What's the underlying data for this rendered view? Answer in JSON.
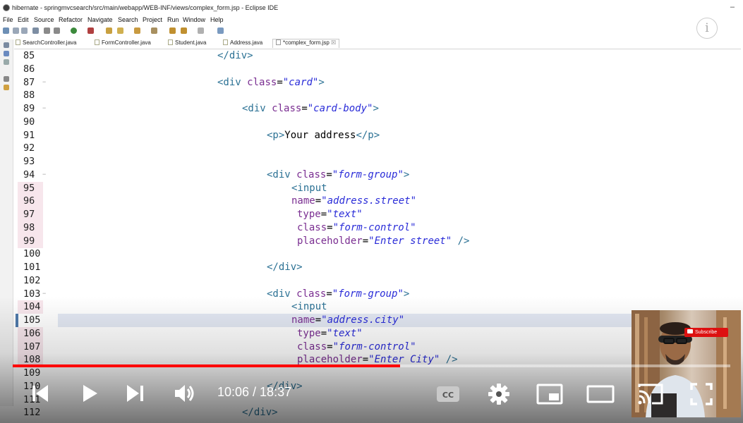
{
  "window": {
    "title": "hibernate - springmvcsearch/src/main/webapp/WEB-INF/views/complex_form.jsp - Eclipse IDE",
    "minimize_label": "–"
  },
  "menu": [
    "File",
    "Edit",
    "Source",
    "Refactor",
    "Navigate",
    "Search",
    "Project",
    "Run",
    "Window",
    "Help"
  ],
  "tabs": [
    {
      "label": "SearchController.java",
      "active": false
    },
    {
      "label": "FormController.java",
      "active": false
    },
    {
      "label": "Student.java",
      "active": false
    },
    {
      "label": "Address.java",
      "active": false
    },
    {
      "label": "*complex_form.jsp",
      "active": true,
      "close": "☒"
    }
  ],
  "info_button": "i",
  "editor": {
    "lines": [
      {
        "n": "85",
        "tokens": [
          [
            "tg",
            "</div>"
          ]
        ]
      },
      {
        "n": "86",
        "tokens": []
      },
      {
        "n": "87",
        "fold": true,
        "tokens": [
          [
            "tg",
            "<div "
          ],
          [
            "at",
            "class"
          ],
          [
            "pt",
            "="
          ],
          [
            "sv",
            "\"card\""
          ],
          [
            "tg",
            ">"
          ]
        ]
      },
      {
        "n": "88",
        "tokens": []
      },
      {
        "n": "89",
        "fold": true,
        "tokens": [
          [
            "tg",
            "<div "
          ],
          [
            "at",
            "class"
          ],
          [
            "pt",
            "="
          ],
          [
            "sv",
            "\"card-body\""
          ],
          [
            "tg",
            ">"
          ]
        ]
      },
      {
        "n": "90",
        "tokens": []
      },
      {
        "n": "91",
        "tokens": [
          [
            "tg",
            "<p>"
          ],
          [
            "pt",
            "Your address"
          ],
          [
            "tg",
            "</p>"
          ]
        ]
      },
      {
        "n": "92",
        "tokens": []
      },
      {
        "n": "93",
        "tokens": []
      },
      {
        "n": "94",
        "fold": true,
        "tokens": [
          [
            "tg",
            "<div "
          ],
          [
            "at",
            "class"
          ],
          [
            "pt",
            "="
          ],
          [
            "sv",
            "\"form-group\""
          ],
          [
            "tg",
            ">"
          ]
        ]
      },
      {
        "n": "95",
        "pink": true,
        "tokens": [
          [
            "tg",
            "<input"
          ]
        ]
      },
      {
        "n": "96",
        "pink": true,
        "tokens": [
          [
            "at",
            "name"
          ],
          [
            "pt",
            "="
          ],
          [
            "sv",
            "\"address.street\""
          ]
        ]
      },
      {
        "n": "97",
        "pink": true,
        "tokens": [
          [
            "at",
            "type"
          ],
          [
            "pt",
            "="
          ],
          [
            "sv",
            "\"text\""
          ]
        ]
      },
      {
        "n": "98",
        "pink": true,
        "tokens": [
          [
            "at",
            "class"
          ],
          [
            "pt",
            "="
          ],
          [
            "sv",
            "\"form-control\""
          ]
        ]
      },
      {
        "n": "99",
        "pink": true,
        "tokens": [
          [
            "at",
            "placeholder"
          ],
          [
            "pt",
            "="
          ],
          [
            "sv",
            "\"Enter street\""
          ],
          [
            "tg",
            " />"
          ]
        ]
      },
      {
        "n": "100",
        "tokens": []
      },
      {
        "n": "101",
        "tokens": [
          [
            "tg",
            "</div>"
          ]
        ]
      },
      {
        "n": "102",
        "tokens": []
      },
      {
        "n": "103",
        "fold": true,
        "tokens": [
          [
            "tg",
            "<div "
          ],
          [
            "at",
            "class"
          ],
          [
            "pt",
            "="
          ],
          [
            "sv",
            "\"form-group\""
          ],
          [
            "tg",
            ">"
          ]
        ]
      },
      {
        "n": "104",
        "pink": true,
        "tokens": [
          [
            "tg",
            "<input"
          ]
        ]
      },
      {
        "n": "105",
        "current": true,
        "tokens": [
          [
            "at",
            "name"
          ],
          [
            "pt",
            "="
          ],
          [
            "sv",
            "\"address.city\""
          ]
        ]
      },
      {
        "n": "106",
        "pink": true,
        "tokens": [
          [
            "at",
            "type"
          ],
          [
            "pt",
            "="
          ],
          [
            "sv",
            "\"text\""
          ]
        ]
      },
      {
        "n": "107",
        "pink": true,
        "tokens": [
          [
            "at",
            "class"
          ],
          [
            "pt",
            "="
          ],
          [
            "sv",
            "\"form-control\""
          ]
        ]
      },
      {
        "n": "108",
        "pink": true,
        "tokens": [
          [
            "at",
            "placeholder"
          ],
          [
            "pt",
            "="
          ],
          [
            "sv",
            "\"Enter City\""
          ],
          [
            "tg",
            " />"
          ]
        ]
      },
      {
        "n": "109",
        "tokens": []
      },
      {
        "n": "110",
        "tokens": [
          [
            "tg",
            "</div>"
          ]
        ]
      },
      {
        "n": "111",
        "tokens": []
      },
      {
        "n": "112",
        "tokens": [
          [
            "tg",
            "</div>"
          ]
        ]
      }
    ]
  },
  "player": {
    "time": "10:06 / 18:37",
    "progress": 0.54,
    "subscribe_label": "Subscribe",
    "colors": {
      "progress": "#ff0000",
      "icons": "#ffffff"
    },
    "icons": [
      "previous-icon",
      "play-icon",
      "next-icon",
      "volume-icon",
      "captions-icon",
      "settings-icon",
      "miniplayer-icon",
      "theater-mode-icon",
      "cast-icon",
      "fullscreen-icon"
    ]
  }
}
